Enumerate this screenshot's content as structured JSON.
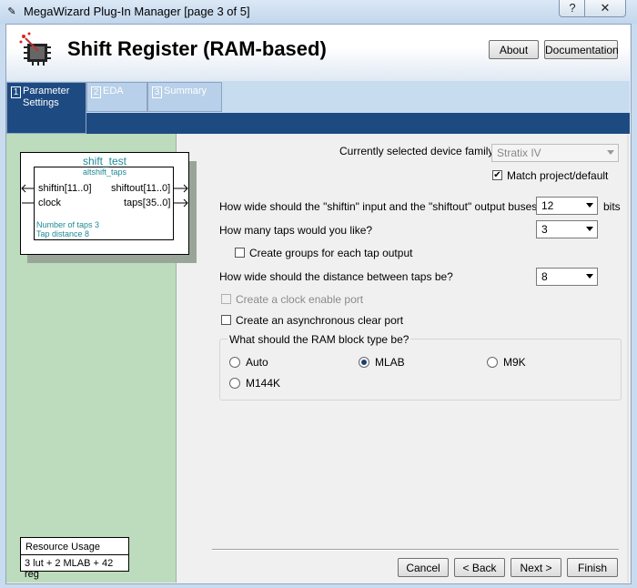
{
  "window": {
    "title": "MegaWizard Plug-In Manager [page 3 of 5]",
    "help": "?",
    "close": "✕"
  },
  "header": {
    "title": "Shift Register (RAM-based)",
    "about": "About",
    "documentation": "Documentation"
  },
  "tabs": [
    {
      "num": "1",
      "label": "Parameter",
      "label2": "Settings"
    },
    {
      "num": "2",
      "label": "EDA"
    },
    {
      "num": "3",
      "label": "Summary"
    }
  ],
  "symbol": {
    "name": "shift_test",
    "module": "altshift_taps",
    "in_port1": "shiftin[11..0]",
    "in_port2": "clock",
    "out_port1": "shiftout[11..0]",
    "out_port2": "taps[35..0]",
    "info1": "Number of taps 3",
    "info2": "Tap distance 8"
  },
  "resource": {
    "title": "Resource Usage",
    "value": "3 lut + 2 MLAB + 42 reg"
  },
  "device": {
    "label": "Currently selected device family:",
    "value": "Stratix IV",
    "match_label": "Match project/default",
    "match_checked": "✔"
  },
  "q_width": {
    "label": "How wide should the \"shiftin\" input and the \"shiftout\" output buses be?",
    "value": "12",
    "unit": "bits"
  },
  "q_taps": {
    "label": "How many taps would you like?",
    "value": "3"
  },
  "groups_label": "Create groups for each tap output",
  "q_distance": {
    "label": "How wide should the distance between taps be?",
    "value": "8"
  },
  "clock_enable_label": "Create a clock enable port",
  "aclr_label": "Create an asynchronous clear port",
  "ram": {
    "label": "What should the RAM block type be?",
    "opt_auto": "Auto",
    "opt_mlab": "MLAB",
    "opt_m9k": "M9K",
    "opt_m144k": "M144K",
    "selected": "MLAB"
  },
  "footer": {
    "cancel": "Cancel",
    "back": "< Back",
    "next": "Next >",
    "finish": "Finish"
  },
  "colors": {
    "header_navy": "#1e4a82",
    "left_pane": "#bddbbd",
    "teal_text": "#1e8a96"
  }
}
